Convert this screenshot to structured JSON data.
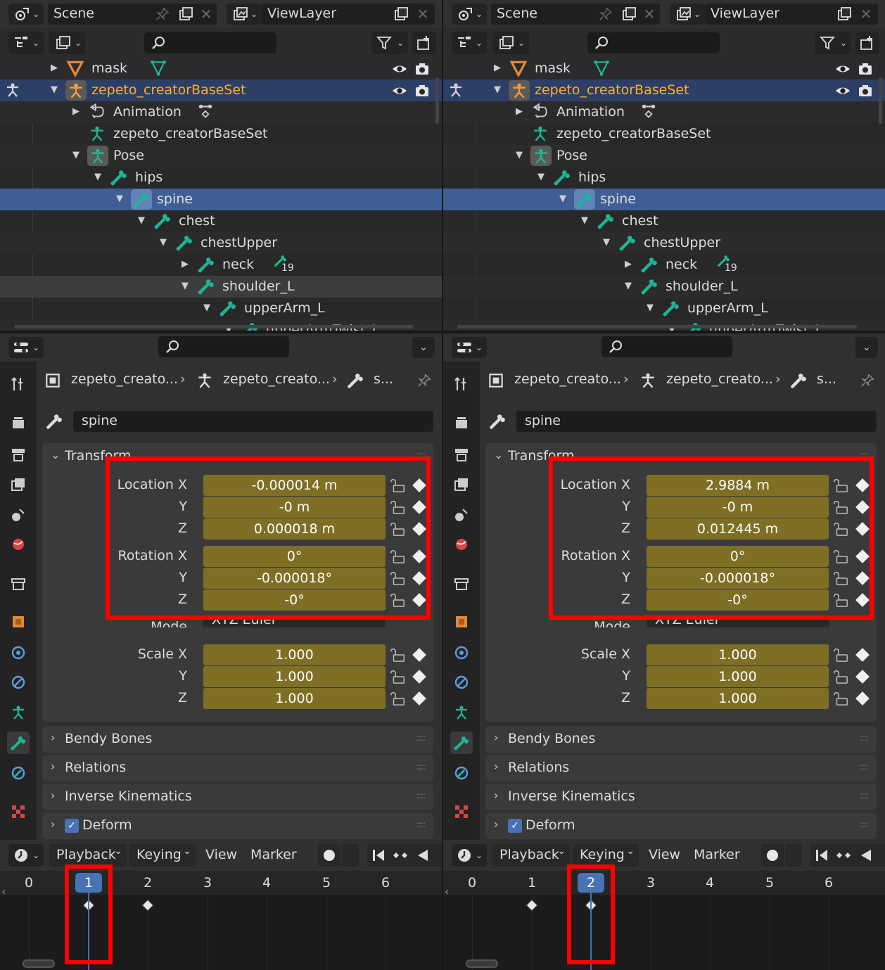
{
  "panes": [
    {
      "scene": "Scene",
      "view_layer": "ViewLayer",
      "outliner_rows": [
        {
          "label": "mask",
          "indent": 0,
          "expand": "right",
          "kind": "mask",
          "eye": true,
          "active": false,
          "row": "even"
        },
        {
          "label": "zepeto_creatorBaseSet",
          "indent": 0,
          "expand": "down",
          "kind": "armature-object",
          "eye": true,
          "active": true,
          "row": "selobj"
        },
        {
          "label": "Animation",
          "indent": 1,
          "expand": "right",
          "kind": "animation",
          "eye": false,
          "active": false,
          "row": "even"
        },
        {
          "label": "zepeto_creatorBaseSet",
          "indent": 1,
          "expand": "",
          "kind": "armature-data",
          "eye": false,
          "active": false,
          "row": "odd"
        },
        {
          "label": "Pose",
          "indent": 1,
          "expand": "down",
          "kind": "pose",
          "eye": false,
          "active": false,
          "row": "even"
        },
        {
          "label": "hips",
          "indent": 2,
          "expand": "down",
          "kind": "bone",
          "eye": false,
          "active": false,
          "row": "odd"
        },
        {
          "label": "spine",
          "indent": 3,
          "expand": "down",
          "kind": "bone-active",
          "eye": false,
          "active": false,
          "row": "selbone"
        },
        {
          "label": "chest",
          "indent": 4,
          "expand": "down",
          "kind": "bone",
          "eye": false,
          "active": false,
          "row": "odd"
        },
        {
          "label": "chestUpper",
          "indent": 5,
          "expand": "down",
          "kind": "bone",
          "eye": false,
          "active": false,
          "row": "even"
        },
        {
          "label": "neck",
          "indent": 6,
          "expand": "right",
          "kind": "bone",
          "eye": false,
          "active": false,
          "row": "odd",
          "badge": "19"
        },
        {
          "label": "shoulder_L",
          "indent": 6,
          "expand": "down",
          "kind": "bone",
          "eye": false,
          "active": false,
          "row": "hl"
        },
        {
          "label": "upperArm_L",
          "indent": 7,
          "expand": "down",
          "kind": "bone",
          "eye": false,
          "active": false,
          "row": "odd"
        },
        {
          "label": "upperArmTwist_L",
          "indent": 8,
          "expand": "down",
          "kind": "bone",
          "eye": false,
          "active": false,
          "row": "even"
        }
      ],
      "breadcrumb": [
        "zepeto_creato...",
        "zepeto_creato...",
        "s..."
      ],
      "bone_name": "spine",
      "transform": {
        "title": "Transform",
        "location": {
          "label_x": "Location X",
          "x": "-0.000014 m",
          "y": "-0 m",
          "z": "0.000018 m"
        },
        "rotation": {
          "label_x": "Rotation X",
          "x": "0°",
          "y": "-0.000018°",
          "z": "-0°"
        },
        "mode": {
          "label": "Mode",
          "value": "XYZ Euler"
        },
        "scale": {
          "label_x": "Scale X",
          "x": "1.000",
          "y": "1.000",
          "z": "1.000"
        },
        "axis_y": "Y",
        "axis_z": "Z"
      },
      "panels": [
        "Bendy Bones",
        "Relations",
        "Inverse Kinematics",
        "Deform"
      ],
      "timeline": {
        "menus": [
          "Playback",
          "Keying",
          "View",
          "Marker"
        ],
        "frames": [
          "0",
          "1",
          "2",
          "3",
          "4",
          "5",
          "6"
        ],
        "current_frame": "1",
        "current_index": 1,
        "keyframes": [
          1,
          2
        ]
      }
    },
    {
      "scene": "Scene",
      "view_layer": "ViewLayer",
      "outliner_rows": [
        {
          "label": "mask",
          "indent": 0,
          "expand": "right",
          "kind": "mask",
          "eye": true,
          "active": false,
          "row": "even"
        },
        {
          "label": "zepeto_creatorBaseSet",
          "indent": 0,
          "expand": "down",
          "kind": "armature-object",
          "eye": true,
          "active": true,
          "row": "selobj"
        },
        {
          "label": "Animation",
          "indent": 1,
          "expand": "right",
          "kind": "animation",
          "eye": false,
          "active": false,
          "row": "even"
        },
        {
          "label": "zepeto_creatorBaseSet",
          "indent": 1,
          "expand": "",
          "kind": "armature-data",
          "eye": false,
          "active": false,
          "row": "odd"
        },
        {
          "label": "Pose",
          "indent": 1,
          "expand": "down",
          "kind": "pose",
          "eye": false,
          "active": false,
          "row": "even"
        },
        {
          "label": "hips",
          "indent": 2,
          "expand": "down",
          "kind": "bone",
          "eye": false,
          "active": false,
          "row": "odd"
        },
        {
          "label": "spine",
          "indent": 3,
          "expand": "down",
          "kind": "bone-active",
          "eye": false,
          "active": false,
          "row": "selbone"
        },
        {
          "label": "chest",
          "indent": 4,
          "expand": "down",
          "kind": "bone",
          "eye": false,
          "active": false,
          "row": "odd"
        },
        {
          "label": "chestUpper",
          "indent": 5,
          "expand": "down",
          "kind": "bone",
          "eye": false,
          "active": false,
          "row": "even"
        },
        {
          "label": "neck",
          "indent": 6,
          "expand": "right",
          "kind": "bone",
          "eye": false,
          "active": false,
          "row": "odd",
          "badge": "19"
        },
        {
          "label": "shoulder_L",
          "indent": 6,
          "expand": "down",
          "kind": "bone",
          "eye": false,
          "active": false,
          "row": "even"
        },
        {
          "label": "upperArm_L",
          "indent": 7,
          "expand": "down",
          "kind": "bone",
          "eye": false,
          "active": false,
          "row": "odd"
        },
        {
          "label": "upperArmTwist_L",
          "indent": 8,
          "expand": "down",
          "kind": "bone",
          "eye": false,
          "active": false,
          "row": "even"
        }
      ],
      "breadcrumb": [
        "zepeto_creato...",
        "zepeto_creato...",
        "s..."
      ],
      "bone_name": "spine",
      "transform": {
        "title": "Transform",
        "location": {
          "label_x": "Location X",
          "x": "2.9884 m",
          "y": "-0 m",
          "z": "0.012445 m"
        },
        "rotation": {
          "label_x": "Rotation X",
          "x": "0°",
          "y": "-0.000018°",
          "z": "-0°"
        },
        "mode": {
          "label": "Mode",
          "value": "XYZ Euler"
        },
        "scale": {
          "label_x": "Scale X",
          "x": "1.000",
          "y": "1.000",
          "z": "1.000"
        },
        "axis_y": "Y",
        "axis_z": "Z"
      },
      "panels": [
        "Bendy Bones",
        "Relations",
        "Inverse Kinematics",
        "Deform"
      ],
      "timeline": {
        "menus": [
          "Playback",
          "Keying",
          "View",
          "Marker"
        ],
        "frames": [
          "0",
          "1",
          "2",
          "3",
          "4",
          "5",
          "6"
        ],
        "current_frame": "2",
        "current_index": 2,
        "keyframes": [
          1,
          2
        ]
      }
    }
  ],
  "colors": {
    "bone": "#1fb59a",
    "active_object": "#ffaf29",
    "keyed_field": "#7e6f25",
    "selection": "#4772b3",
    "highlight_box": "#ff0000"
  },
  "icons": [
    "scene-icon",
    "view-layer-icon",
    "pin-icon",
    "new-icon",
    "close-icon",
    "display-mode-icon",
    "filter-icon",
    "search-icon",
    "eye-icon",
    "camera-icon",
    "mask-icon",
    "armature-icon",
    "bone-icon",
    "pose-icon",
    "action-icon",
    "lock-icon",
    "keyframe-icon",
    "tool-icon",
    "render-icon",
    "output-icon",
    "view-layer-prop-icon",
    "scene-prop-icon",
    "world-icon",
    "collection-icon",
    "object-icon",
    "modifier-icon",
    "physics-icon",
    "constraint-icon",
    "data-icon",
    "bone-prop-icon",
    "bone-constraint-icon",
    "texture-icon",
    "play-icon",
    "jump-start-icon",
    "prev-key-icon",
    "record-icon"
  ]
}
